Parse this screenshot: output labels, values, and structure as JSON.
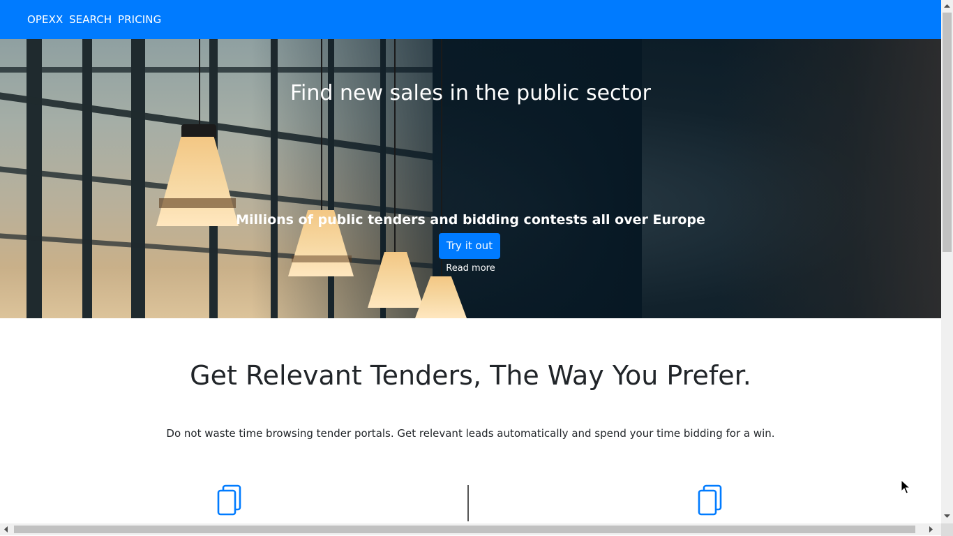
{
  "nav": {
    "brand": "OPEXX",
    "items": [
      "SEARCH",
      "PRICING"
    ]
  },
  "hero": {
    "title": "Find new sales in the public sector",
    "subtitle": "Millions of public tenders and bidding contests all over Europe",
    "cta_label": "Try it out",
    "read_more": "Read more"
  },
  "features": {
    "title": "Get Relevant Tenders, The Way You Prefer.",
    "description": "Do not waste time browsing tender portals. Get relevant leads automatically and spend your time bidding for a win.",
    "icons": [
      "documents-icon",
      "documents-icon"
    ]
  },
  "colors": {
    "primary": "#007bff",
    "text": "#212529",
    "hero_dark": "#071824"
  }
}
